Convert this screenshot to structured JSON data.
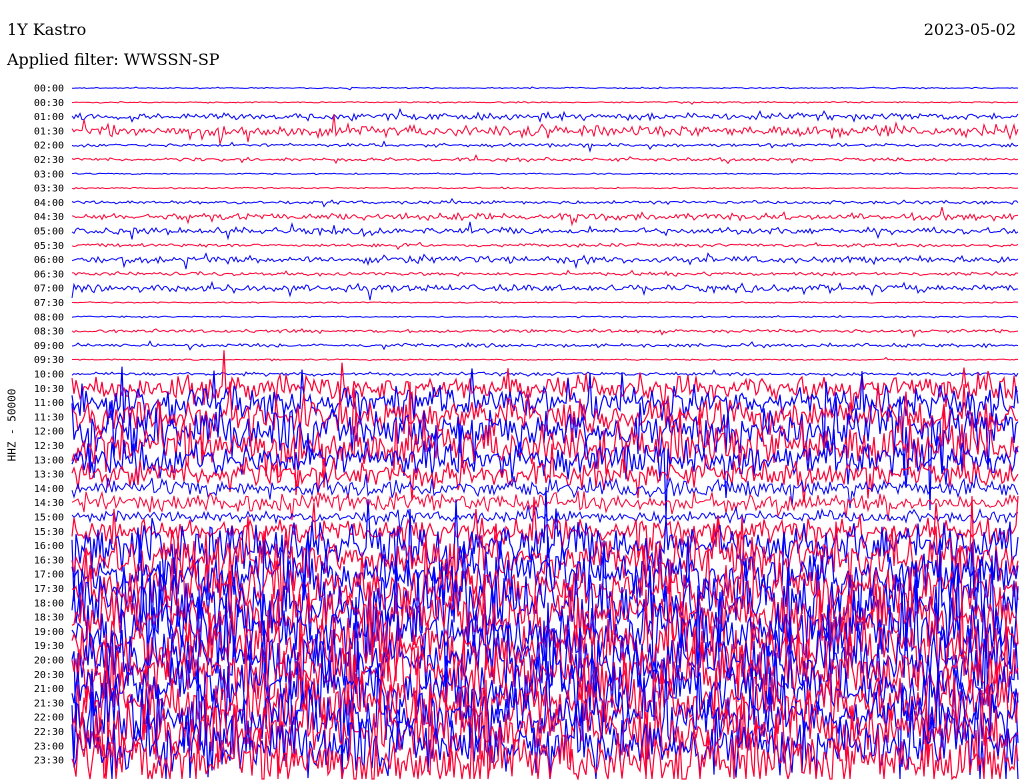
{
  "header": {
    "station": "1Y Kastro",
    "date": "2023-05-02",
    "filter": "Applied filter: WWSSN-SP"
  },
  "colors": {
    "trace_a": "#0000ff",
    "trace_b": "#ff0033",
    "background": "#ffffff"
  },
  "chart_data": {
    "type": "line",
    "chart_kind": "helicorder",
    "ylabel": "HHZ - 50000",
    "rows": [
      "00:00",
      "00:30",
      "01:00",
      "01:30",
      "02:00",
      "02:30",
      "03:00",
      "03:30",
      "04:00",
      "04:30",
      "05:00",
      "05:30",
      "06:00",
      "06:30",
      "07:00",
      "07:30",
      "08:00",
      "08:30",
      "09:00",
      "09:30",
      "10:00",
      "10:30",
      "11:00",
      "11:30",
      "12:00",
      "12:30",
      "13:00",
      "13:30",
      "14:00",
      "14:30",
      "15:00",
      "15:30",
      "16:00",
      "16:30",
      "17:00",
      "17:30",
      "18:00",
      "18:30",
      "19:00",
      "19:30",
      "20:00",
      "20:30",
      "21:00",
      "21:30",
      "22:00",
      "22:30",
      "23:00",
      "23:30"
    ],
    "row_colors": [
      "trace_a",
      "trace_b"
    ],
    "minutes_per_row": 30,
    "grid": false,
    "legend": "none",
    "activity_note": "quiet traces in early hours; dense high-amplitude signal from about 10:30 onward",
    "noise_level": [
      1,
      1,
      3,
      4,
      2,
      2,
      1,
      1,
      2,
      3,
      3,
      2,
      3,
      2,
      3,
      1,
      1,
      2,
      2,
      1,
      2,
      6,
      7,
      7,
      8,
      8,
      7,
      6,
      5,
      5,
      4,
      6,
      8,
      8,
      8,
      8,
      9,
      9,
      9,
      9,
      9,
      9,
      9,
      9,
      9,
      9,
      9,
      9
    ]
  }
}
